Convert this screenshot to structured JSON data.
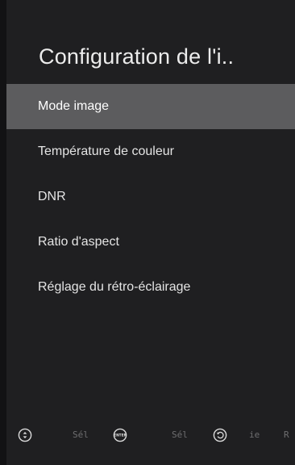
{
  "title": "Configuration de l'i..",
  "menu": {
    "items": [
      {
        "label": "Mode image",
        "selected": true
      },
      {
        "label": "Température de couleur",
        "selected": false
      },
      {
        "label": "DNR",
        "selected": false
      },
      {
        "label": "Ratio d'aspect",
        "selected": false
      },
      {
        "label": "Réglage du rétro-éclairage",
        "selected": false
      }
    ]
  },
  "footer": {
    "hints": [
      {
        "icon": "up-down-arrows-icon",
        "label": "Sél"
      },
      {
        "icon": "enter-icon",
        "label": "Sél"
      },
      {
        "icon": "back-icon",
        "label": "ie"
      }
    ],
    "trailing_label": "R"
  },
  "colors": {
    "background": "#1f1f21",
    "selected_row": "#5c5c5e",
    "text": "#e4e4e4",
    "hint_text": "#6e6e70"
  }
}
